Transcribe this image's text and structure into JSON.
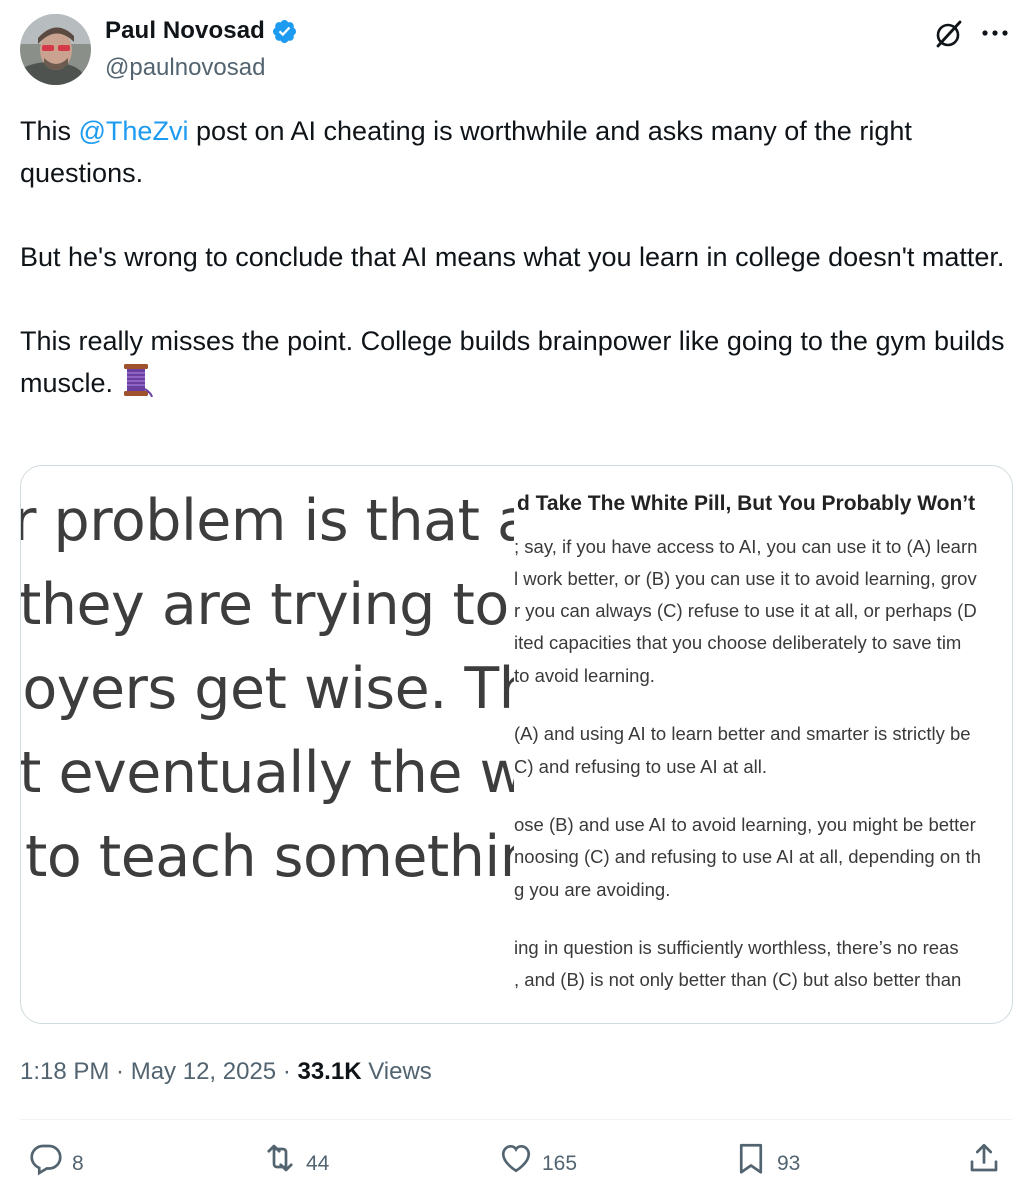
{
  "author": {
    "display_name": "Paul Novosad",
    "handle": "@paulnovosad",
    "verified": true
  },
  "tweet": {
    "text_before_mention": "This ",
    "mention": "@TheZvi",
    "text_after_mention": " post on AI cheating is worthwhile and asks many of the right questions.\n\nBut he's wrong to conclude that AI means what you learn in college doesn't matter.\n\nThis really misses the point. College builds brainpower like going to the gym builds muscle. ",
    "emoji": "thread-spool-emoji"
  },
  "media": {
    "left_lines": [
      "r problem is that a deg",
      "they are trying to conv",
      "loyers get wise. There",
      "t eventually the whole",
      "to teach something tl"
    ],
    "right_title": "d Take The White Pill, But You Probably Won’t",
    "right_lines": [
      "; say, if you have access to AI, you can use it to (A) learn",
      "l work better, or (B) you can use it to avoid learning, grov",
      "r you can always (C) refuse to use it at all, or perhaps (D",
      "ited capacities that you choose deliberately to save tim",
      "to avoid learning.",
      "(A) and using AI to learn better and smarter is strictly be",
      "C) and refusing to use AI at all.",
      "ose (B) and use AI to avoid learning, you might be better",
      "noosing (C) and refusing to use AI at all, depending on th",
      "g you are avoiding.",
      "ing in question is sufficiently worthless, there’s no reas",
      ", and (B) is not only better than (C) but also better than"
    ]
  },
  "meta": {
    "time": "1:18 PM",
    "separator": " · ",
    "date": "May 12, 2025",
    "views_count": "33.1K",
    "views_label": " Views"
  },
  "actions": {
    "replies": "8",
    "reposts": "44",
    "likes": "165",
    "bookmarks": "93"
  },
  "colors": {
    "accent": "#1d9bf0",
    "muted": "#536471",
    "text": "#0f1419",
    "border": "#cfd9de"
  }
}
